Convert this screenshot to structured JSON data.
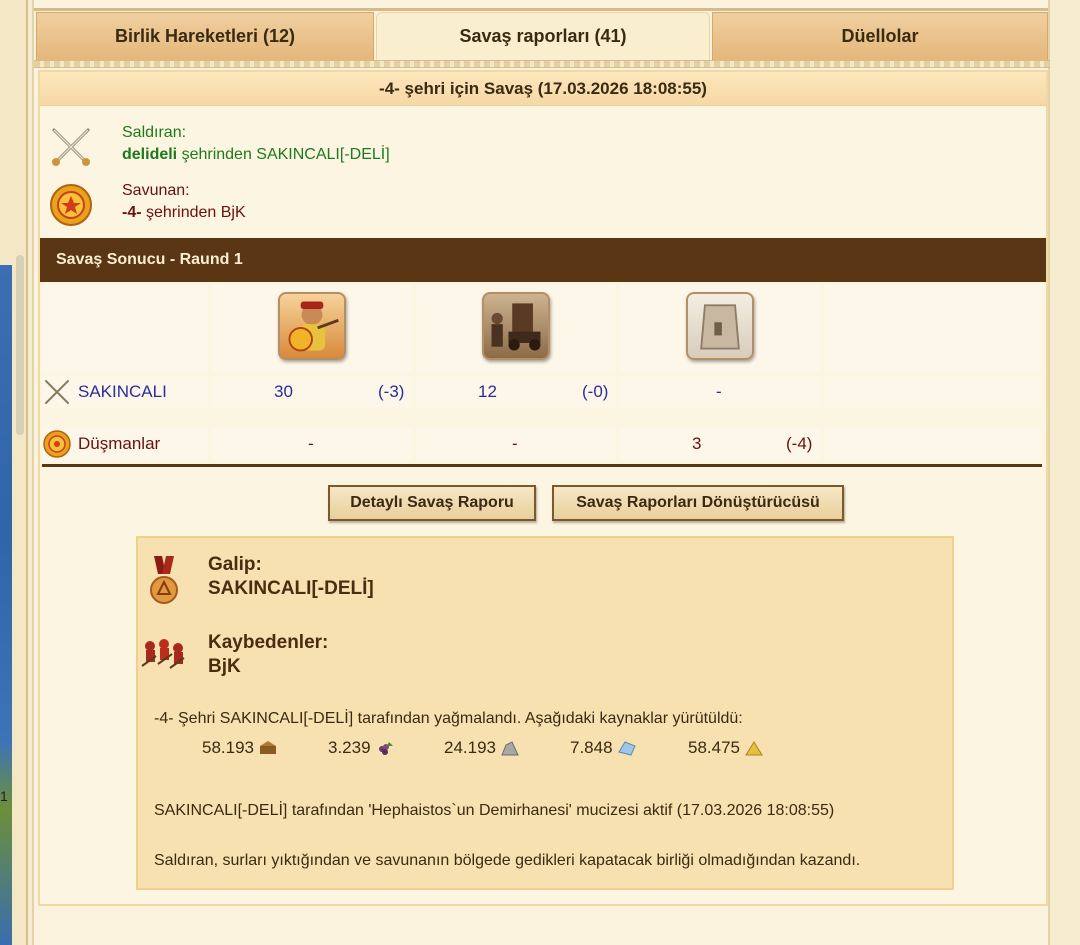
{
  "tabs": [
    {
      "label": "Birlik Hareketleri (12)",
      "active": false
    },
    {
      "label": "Savaş raporları (41)",
      "active": true
    },
    {
      "label": "Düellolar",
      "active": false
    }
  ],
  "left_strip": {
    "number": "1"
  },
  "report": {
    "title": "-4- şehri için Savaş (17.03.2026 18:08:55)",
    "attacker": {
      "label": "Saldıran:",
      "city": "delideli",
      "detail": " şehrinden SAKINCALI[-DELİ]",
      "icon": "crossed-swords-icon"
    },
    "defender": {
      "label": "Savunan:",
      "city": "-4-",
      "detail": " şehrinden BjK",
      "icon": "shield-icon"
    },
    "result_title": "Savaş Sonucu - Raund 1",
    "units": [
      "hoplite-unit-icon",
      "catapult-unit-icon",
      "wall-unit-icon"
    ],
    "attacker_row": {
      "name": "SAKINCALI",
      "cells": [
        {
          "count": "30",
          "loss": "(-3)"
        },
        {
          "count": "12",
          "loss": "(-0)"
        },
        {
          "count": "-",
          "loss": ""
        }
      ]
    },
    "defender_row": {
      "name": "Düşmanlar",
      "cells": [
        {
          "count": "-",
          "loss": ""
        },
        {
          "count": "-",
          "loss": ""
        },
        {
          "count": "3",
          "loss": "(-4)"
        }
      ]
    },
    "buttons": {
      "detailed": "Detaylı Savaş Raporu",
      "converter": "Savaş Raporları Dönüştürücüsü"
    },
    "summary": {
      "winner_label": "Galip:",
      "winner": "SAKINCALI[-DELİ]",
      "losers_label": "Kaybedenler:",
      "losers": "BjK",
      "plunder_text": "-4- Şehri SAKINCALI[-DELİ] tarafından yağmalandı. Aşağıdaki kaynaklar yürütüldü:",
      "resources": [
        {
          "amount": "58.193",
          "icon": "wood-icon"
        },
        {
          "amount": "3.239",
          "icon": "wine-icon"
        },
        {
          "amount": "24.193",
          "icon": "marble-icon"
        },
        {
          "amount": "7.848",
          "icon": "crystal-icon"
        },
        {
          "amount": "58.475",
          "icon": "sulfur-icon"
        }
      ],
      "wonder_text": "SAKINCALI[-DELİ] tarafından 'Hephaistos`un Demirhanesi' mucizesi aktif (17.03.2026 18:08:55)",
      "reason_text": "Saldıran, surları yıktığından ve savunanın bölgede gedikleri kapatacak birliği olmadığından kazandı."
    }
  },
  "colors": {
    "result_bar": "#5a3614",
    "attacker_text": "#1c7a1c",
    "defender_text": "#6a1010",
    "player_link": "#2a2d9b"
  }
}
